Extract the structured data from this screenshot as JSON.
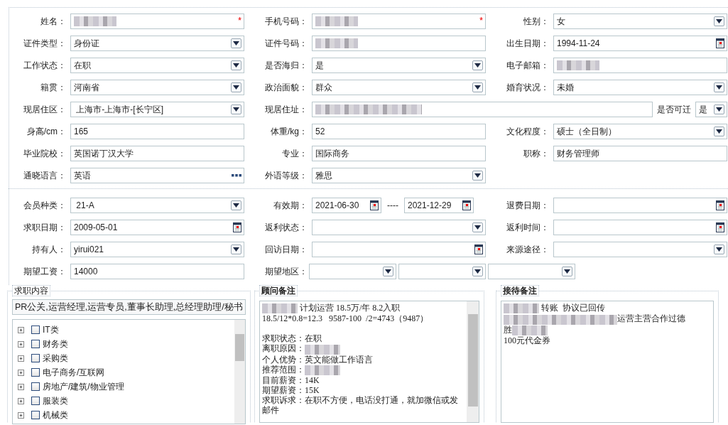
{
  "personal": {
    "rows": [
      [
        {
          "label": "姓名：",
          "kind": "text",
          "redacted": true,
          "required_mark": "*"
        },
        {
          "label": "手机号码：",
          "kind": "text",
          "redacted": true,
          "required_mark": "*"
        },
        {
          "label": "性别：",
          "kind": "select",
          "value": "女"
        }
      ],
      [
        {
          "label": "证件类型：",
          "kind": "select",
          "value": "身份证"
        },
        {
          "label": "证件号码：",
          "kind": "text",
          "redacted": true
        },
        {
          "label": "出生日期：",
          "kind": "date",
          "value": "1994-11-24"
        }
      ],
      [
        {
          "label": "工作状态：",
          "kind": "select",
          "value": "在职"
        },
        {
          "label": "是否海归：",
          "kind": "select",
          "value": "是"
        },
        {
          "label": "电子邮箱：",
          "kind": "text",
          "redacted": true
        }
      ],
      [
        {
          "label": "籍贯：",
          "kind": "select",
          "value": "河南省"
        },
        {
          "label": "政治面貌：",
          "kind": "select",
          "value": "群众"
        },
        {
          "label": "婚育状况：",
          "kind": "select",
          "value": "未婚"
        }
      ],
      [
        {
          "label": "现居住区：",
          "kind": "select",
          "value": " 上海市-上海市-[长宁区]"
        },
        {
          "label": "现居住址：",
          "kind": "address",
          "redacted": true,
          "extra": {
            "label": "是否可迁",
            "value": "是"
          }
        }
      ],
      [
        {
          "label": "身高/cm：",
          "kind": "text",
          "value": "165"
        },
        {
          "label": "体重/kg：",
          "kind": "text",
          "value": "52"
        },
        {
          "label": "文化程度：",
          "kind": "select",
          "value": "硕士（全日制）"
        }
      ],
      [
        {
          "label": "毕业院校：",
          "kind": "text",
          "value": "英国诺丁汉大学"
        },
        {
          "label": "专业：",
          "kind": "text",
          "value": "国际商务"
        },
        {
          "label": "职称：",
          "kind": "text",
          "value": "财务管理师"
        }
      ],
      [
        {
          "label": "通晓语言：",
          "kind": "picker",
          "value": "英语"
        },
        {
          "label": "外语等级：",
          "kind": "select",
          "value": "雅思"
        }
      ]
    ]
  },
  "membership": {
    "rows": [
      [
        {
          "label": "会员种类：",
          "kind": "select",
          "value": " 21-A"
        },
        {
          "label": "有效期：",
          "kind": "date_range",
          "from": "2021-06-30",
          "separator": "----",
          "to": "2021-12-29"
        },
        {
          "label": "退费日期：",
          "kind": "date"
        }
      ],
      [
        {
          "label": "求职日期：",
          "kind": "date",
          "value": "2009-05-01"
        },
        {
          "label": "返利状态：",
          "kind": "select"
        },
        {
          "label": "返利时间：",
          "kind": "date"
        }
      ],
      [
        {
          "label": "持有人：",
          "kind": "select",
          "value": "yirui021"
        },
        {
          "label": "回访日期：",
          "kind": "date"
        },
        {
          "label": "来源途径：",
          "kind": "select"
        }
      ],
      [
        {
          "label": "期望工资：",
          "kind": "text",
          "value": "14000"
        },
        {
          "label": "期望地区：",
          "kind": "select_group",
          "parts": [
            {
              "kind": "select"
            },
            {
              "kind": "select"
            },
            {
              "kind": "select"
            }
          ]
        }
      ]
    ]
  },
  "job_intent": {
    "legend": "求职内容",
    "selected_text": "PR公关,运营经理,运营专员,董事长助理,总经理助理/秘书",
    "categories": [
      {
        "label": "IT类",
        "expanded": false,
        "checked": false
      },
      {
        "label": "财务类",
        "expanded": false,
        "checked": false
      },
      {
        "label": "采购类",
        "expanded": false,
        "checked": false
      },
      {
        "label": "电子商务/互联网",
        "expanded": false,
        "checked": false
      },
      {
        "label": "房地产/建筑/物业管理",
        "expanded": false,
        "checked": false
      },
      {
        "label": "服装类",
        "expanded": false,
        "checked": false
      },
      {
        "label": "机械类",
        "expanded": false,
        "checked": false
      }
    ]
  },
  "consultant_notes": {
    "legend": "顾问备注",
    "lines": [
      {
        "parts": [
          {
            "kind": "redacted"
          },
          {
            "kind": "text",
            "text": " 计划运营 18.5万/年 8.2入职"
          }
        ]
      },
      {
        "parts": [
          {
            "kind": "text",
            "text": "18.5/12*0.8=12.3   9587-100  /2=4743（9487）"
          }
        ]
      },
      {
        "gap_before": true,
        "parts": [
          {
            "kind": "text",
            "text": "求职状态：在职"
          }
        ]
      },
      {
        "parts": [
          {
            "kind": "text",
            "text": "离职原因："
          },
          {
            "kind": "redacted"
          }
        ]
      },
      {
        "parts": [
          {
            "kind": "text",
            "text": "个人优势：英文能做工作语言"
          }
        ]
      },
      {
        "parts": [
          {
            "kind": "text",
            "text": "推荐范围："
          },
          {
            "kind": "redacted"
          }
        ]
      },
      {
        "parts": [
          {
            "kind": "text",
            "text": "目前薪资：14K"
          }
        ]
      },
      {
        "parts": [
          {
            "kind": "text",
            "text": "期望薪资：15K"
          }
        ]
      },
      {
        "parts": [
          {
            "kind": "text",
            "text": "求职诉求：在职不方便，电话没打通，就加微信或发邮件"
          }
        ]
      }
    ]
  },
  "reception_notes": {
    "legend": "接待备注",
    "lines": [
      {
        "parts": [
          {
            "kind": "redacted"
          },
          {
            "kind": "text",
            "text": " 转账  协议已回传"
          }
        ]
      },
      {
        "parts": [
          {
            "kind": "redacted_long"
          },
          {
            "kind": "text",
            "text": "运营主营合作过德"
          }
        ]
      },
      {
        "parts": [
          {
            "kind": "text",
            "text": "胜"
          },
          {
            "kind": "redacted"
          }
        ]
      },
      {
        "parts": [
          {
            "kind": "text",
            "text": "100元代金券"
          }
        ]
      }
    ]
  }
}
